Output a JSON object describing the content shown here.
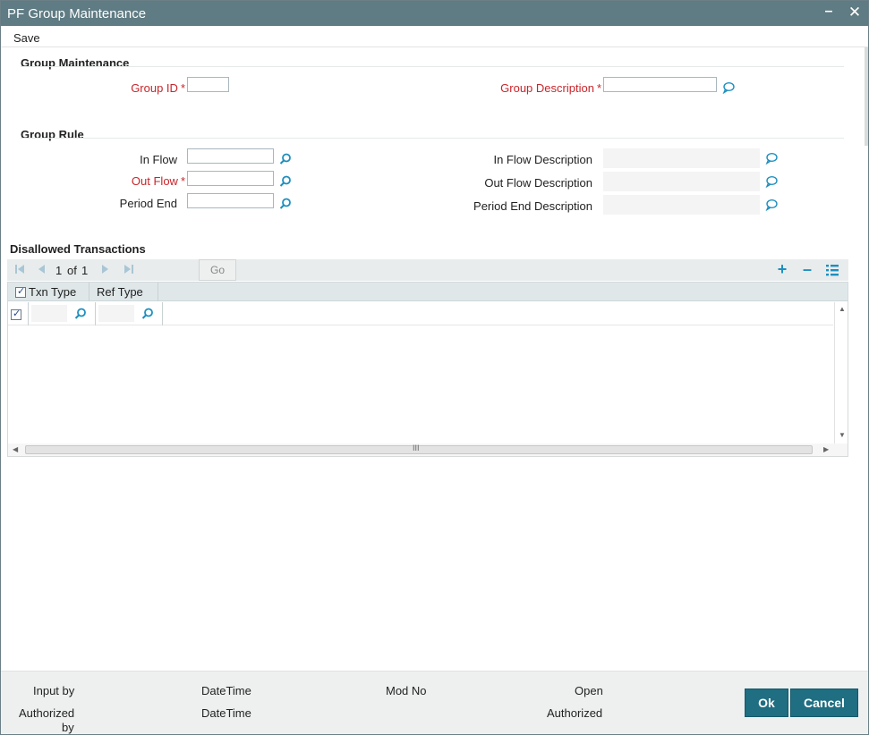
{
  "window": {
    "title": "PF Group Maintenance",
    "minimize": "–",
    "close": "✕"
  },
  "menu": {
    "save_label": "Save"
  },
  "group_maintenance": {
    "section_title": "Group Maintenance",
    "group_id_label": "Group ID",
    "group_id_value": "",
    "group_description_label": "Group Description",
    "group_description_value": "",
    "required_marker": "*"
  },
  "group_rule": {
    "section_title": "Group Rule",
    "in_flow_label": "In Flow",
    "out_flow_label": "Out Flow",
    "period_end_label": "Period End",
    "in_flow_desc_label": "In Flow Description",
    "out_flow_desc_label": "Out Flow Description",
    "period_end_desc_label": "Period End Description",
    "required_marker": "*"
  },
  "disallowed": {
    "section_title": "Disallowed Transactions",
    "page_current": "1",
    "page_of": "of",
    "page_total": "1",
    "go_label": "Go",
    "columns": [
      "Txn Type",
      "Ref Type"
    ],
    "scroll_grip": "III"
  },
  "footer": {
    "input_by_label": "Input by",
    "datetime_label_1": "DateTime",
    "mod_no_label": "Mod No",
    "open_label": "Open",
    "authorized_by_label_line1": "Authorized",
    "authorized_by_label_line2": "by",
    "datetime_label_2": "DateTime",
    "authorized_label": "Authorized",
    "ok_label": "Ok",
    "cancel_label": "Cancel"
  },
  "colors": {
    "titlebar": "#5f7b83",
    "required": "#c8252b",
    "accent": "#1d8fbf",
    "button": "#1f6e82"
  },
  "icons": {
    "lookup": "search-icon",
    "description": "speech-bubble-icon"
  }
}
